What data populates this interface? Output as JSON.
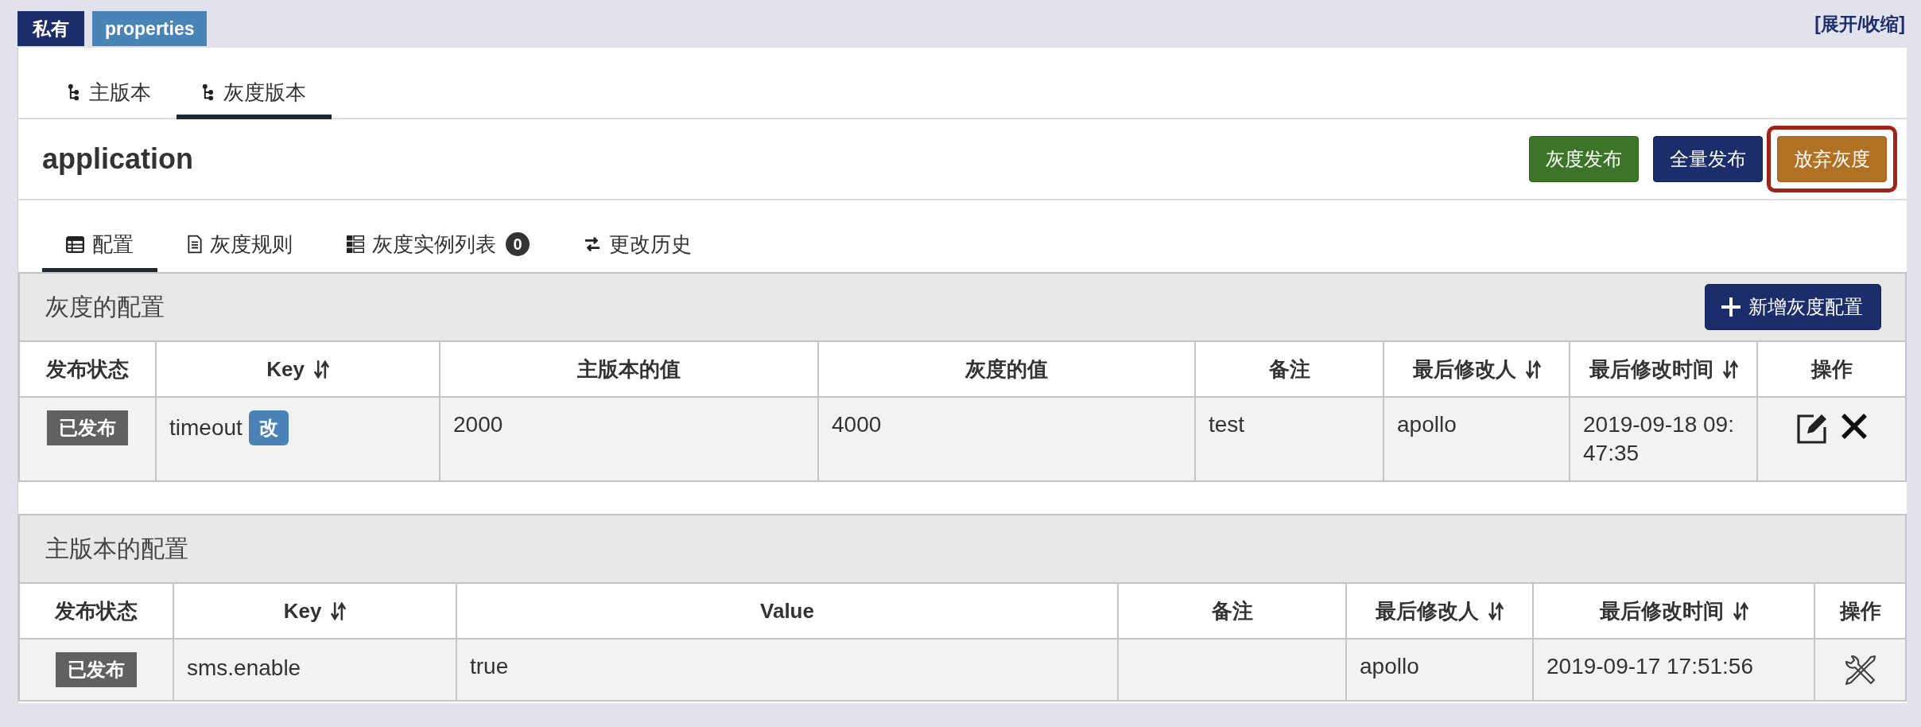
{
  "header": {
    "badges": [
      {
        "label": "私有",
        "kind": "scope"
      },
      {
        "label": "properties",
        "kind": "format"
      }
    ],
    "toggle_link": "[展开/收缩]"
  },
  "version_tabs": [
    {
      "label": "主版本",
      "selected": false
    },
    {
      "label": "灰度版本",
      "selected": true
    }
  ],
  "namespace": {
    "title": "application",
    "buttons": [
      {
        "label": "灰度发布",
        "kind": "release",
        "highlighted": false
      },
      {
        "label": "全量发布",
        "kind": "merge",
        "highlighted": false
      },
      {
        "label": "放弃灰度",
        "kind": "abandon",
        "highlighted": true
      }
    ]
  },
  "sub_tabs": [
    {
      "label": "配置",
      "kind": "table",
      "selected": true
    },
    {
      "label": "灰度规则",
      "kind": "rules",
      "selected": false
    },
    {
      "label": "灰度实例列表",
      "kind": "instances",
      "badge": "0",
      "selected": false
    },
    {
      "label": "更改历史",
      "kind": "history",
      "selected": false
    }
  ],
  "sections": [
    {
      "title": "灰度的配置",
      "add_button": "新增灰度配置",
      "table": {
        "columns": [
          {
            "label": "发布状态",
            "sortable": false
          },
          {
            "label": "Key",
            "sortable": true
          },
          {
            "label": "主版本的值",
            "sortable": false
          },
          {
            "label": "灰度的值",
            "sortable": false
          },
          {
            "label": "备注",
            "sortable": false
          },
          {
            "label": "最后修改人",
            "sortable": true
          },
          {
            "label": "最后修改时间",
            "sortable": true
          },
          {
            "label": "操作",
            "sortable": false
          }
        ],
        "rows": [
          {
            "cells": [
              {
                "kind": "status",
                "text": "已发布"
              },
              {
                "kind": "key",
                "text": "timeout",
                "badge": "改"
              },
              {
                "kind": "text",
                "text": "2000"
              },
              {
                "kind": "text",
                "text": "4000"
              },
              {
                "kind": "text",
                "text": "test"
              },
              {
                "kind": "text",
                "text": "apollo"
              },
              {
                "kind": "text",
                "text": "2019-09-18 09:47:35"
              },
              {
                "kind": "actions",
                "actions": [
                  {
                    "kind": "edit"
                  },
                  {
                    "kind": "delete"
                  }
                ]
              }
            ]
          }
        ]
      }
    },
    {
      "title": "主版本的配置",
      "table": {
        "columns": [
          {
            "label": "发布状态",
            "sortable": false
          },
          {
            "label": "Key",
            "sortable": true
          },
          {
            "label": "Value",
            "sortable": false
          },
          {
            "label": "备注",
            "sortable": false
          },
          {
            "label": "最后修改人",
            "sortable": true
          },
          {
            "label": "最后修改时间",
            "sortable": true
          },
          {
            "label": "操作",
            "sortable": false
          }
        ],
        "rows": [
          {
            "cells": [
              {
                "kind": "status",
                "text": "已发布"
              },
              {
                "kind": "key",
                "text": "sms.enable"
              },
              {
                "kind": "text",
                "text": "true"
              },
              {
                "kind": "text"
              },
              {
                "kind": "text",
                "text": "apollo"
              },
              {
                "kind": "text",
                "text": "2019-09-17 17:51:56"
              },
              {
                "kind": "actions",
                "actions": [
                  {
                    "kind": "tools"
                  }
                ]
              }
            ]
          }
        ]
      }
    }
  ]
}
